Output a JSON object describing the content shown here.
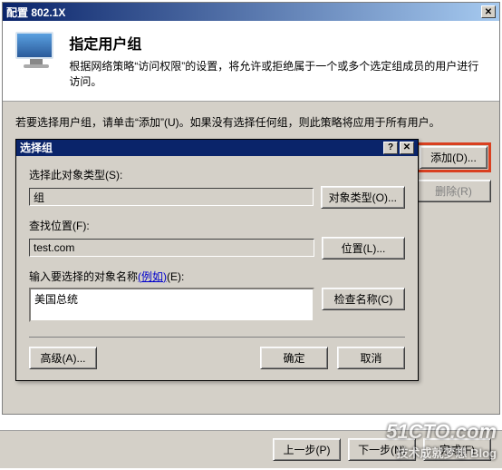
{
  "outer": {
    "title": "配置 802.1X",
    "header_title": "指定用户组",
    "header_desc": "根据网络策略“访问权限”的设置，将允许或拒绝属于一个或多个选定组成员的用户进行访问。",
    "instruction": "若要选择用户组，请单击“添加”(U)。如果没有选择任何组，则此策略将应用于所有用户。",
    "add_btn": "添加(D)...",
    "remove_btn": "删除(R)",
    "prev_btn": "上一步(P)",
    "next_btn": "下一步(N)",
    "finish_btn": "完成(F)"
  },
  "inner": {
    "title": "选择组",
    "label_type": "选择此对象类型(S):",
    "type_value": "组",
    "btn_type": "对象类型(O)...",
    "label_location": "查找位置(F):",
    "location_value": "test.com",
    "btn_location": "位置(L)...",
    "label_name_pre": "输入要选择的对象名称",
    "label_name_link": "(例如)",
    "label_name_post": "(E):",
    "name_value": "美国总统",
    "btn_check": "检查名称(C)",
    "btn_advanced": "高级(A)...",
    "btn_ok": "确定",
    "btn_cancel": "取消"
  },
  "watermark": {
    "line1": "51CTO.com",
    "line2": "技术成就梦想 Blog"
  }
}
